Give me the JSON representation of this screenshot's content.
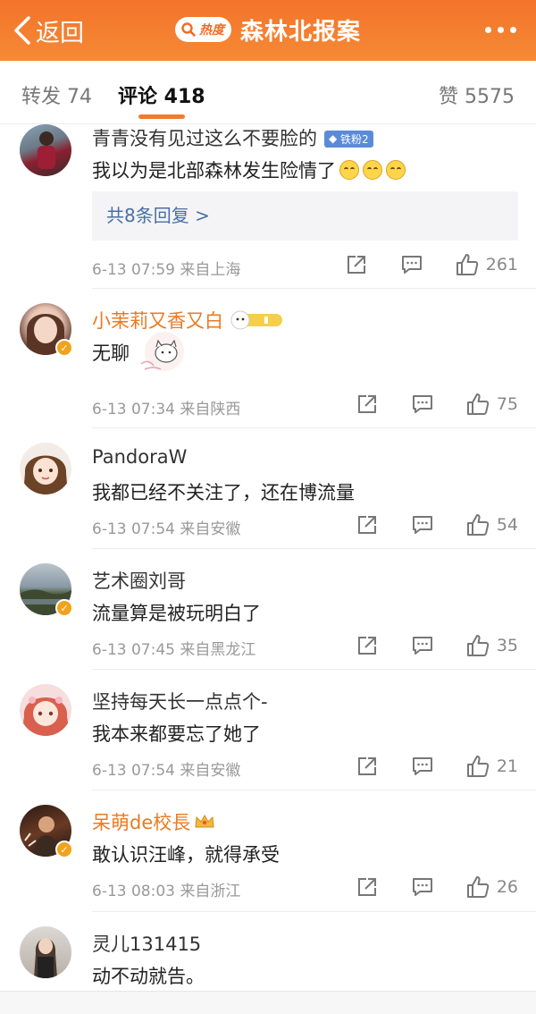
{
  "header": {
    "back_label": "返回",
    "hot_label": "热度",
    "title": "森林北报案"
  },
  "tabs": {
    "repost": "转发 74",
    "comment": "评论 418",
    "like": "赞 5575"
  },
  "comments": [
    {
      "user": "青青没有见过这么不要脸的",
      "badge": "铁粉2",
      "text": "我以为是北部森林发生险情了",
      "replies": "共8条回复 >",
      "time": "6-13 07:59 来自上海",
      "likes": "261"
    },
    {
      "user": "小茉莉又香又白",
      "text": "无聊",
      "time": "6-13 07:34 来自陕西",
      "likes": "75"
    },
    {
      "user": "PandoraW",
      "text": "我都已经不关注了，还在博流量",
      "time": "6-13 07:54 来自安徽",
      "likes": "54"
    },
    {
      "user": "艺术圈刘哥",
      "text": "流量算是被玩明白了",
      "time": "6-13 07:45 来自黑龙江",
      "likes": "35"
    },
    {
      "user": "坚持每天长一点点个-",
      "text": "我本来都要忘了她了",
      "time": "6-13 07:54 来自安徽",
      "likes": "21"
    },
    {
      "user": "呆萌de校長",
      "text": "敢认识汪峰，就得承受",
      "time": "6-13 08:03 来自浙江",
      "likes": "26"
    },
    {
      "user": "灵儿131415",
      "text": "动不动就告。"
    }
  ],
  "colors": {
    "header_orange": "#f4732a",
    "username_orange": "#ea7a22",
    "link_blue": "#4a6fa3",
    "tab_underline": "#f47b2c"
  }
}
